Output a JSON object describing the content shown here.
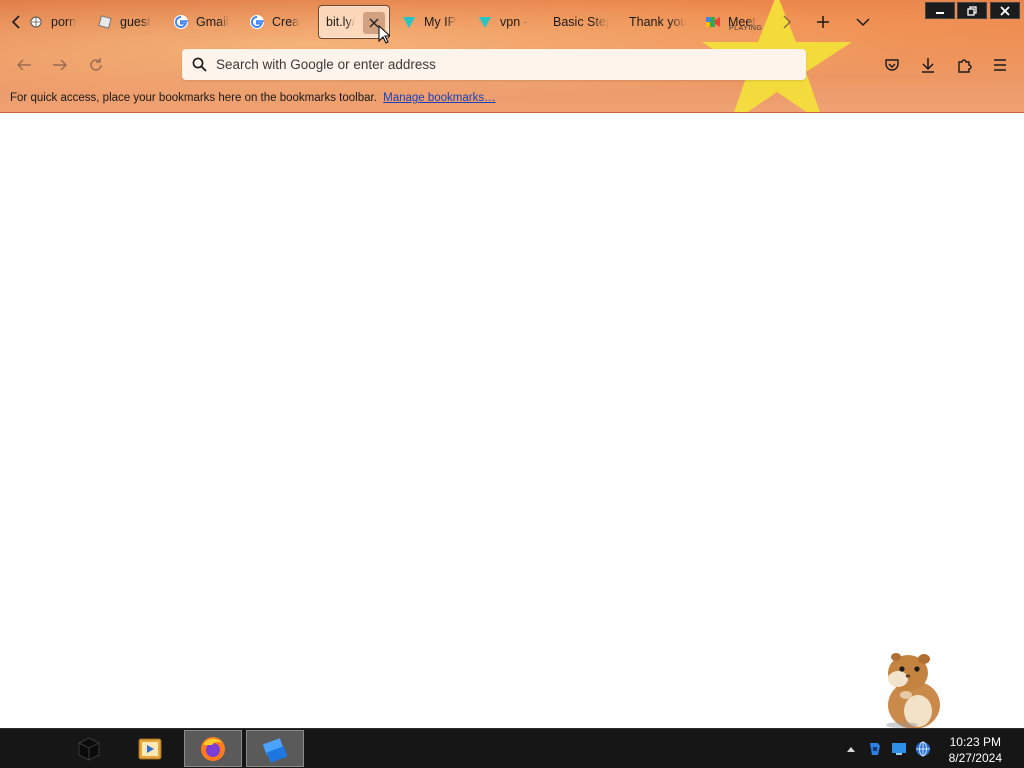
{
  "tabs": [
    {
      "label": "porn",
      "icon": "globe-icon"
    },
    {
      "label": "guest",
      "icon": "roblox-icon"
    },
    {
      "label": "Gmail",
      "icon": "google-icon"
    },
    {
      "label": "Crea",
      "icon": "google-icon"
    },
    {
      "label": "bit.ly/",
      "icon": "",
      "active": true
    },
    {
      "label": "My IP",
      "icon": "vpn-shield-icon"
    },
    {
      "label": "vpn -",
      "icon": "vpn-shield-icon"
    },
    {
      "label": "Basic Step",
      "icon": ""
    },
    {
      "label": "Thank you",
      "icon": ""
    },
    {
      "label": "Meet",
      "sub": "PLAYING",
      "icon": "meet-icon"
    }
  ],
  "navbar": {
    "search_placeholder": "Search with Google or enter address"
  },
  "bookmarks": {
    "message": "For quick access, place your bookmarks here on the bookmarks toolbar.",
    "link": "Manage bookmarks…"
  },
  "taskbar": {
    "apps": [
      "app-black-cube-icon",
      "media-player-icon",
      "firefox-icon",
      "roblox-studio-icon"
    ],
    "active_app": "firefox-icon",
    "clock_time": "10:23 PM",
    "clock_date": "8/27/2024"
  },
  "colors": {
    "theme_orange": "#e9915c",
    "star_yellow": "#f4e13a",
    "taskbar": "#161616",
    "link": "#1a3fb8"
  }
}
